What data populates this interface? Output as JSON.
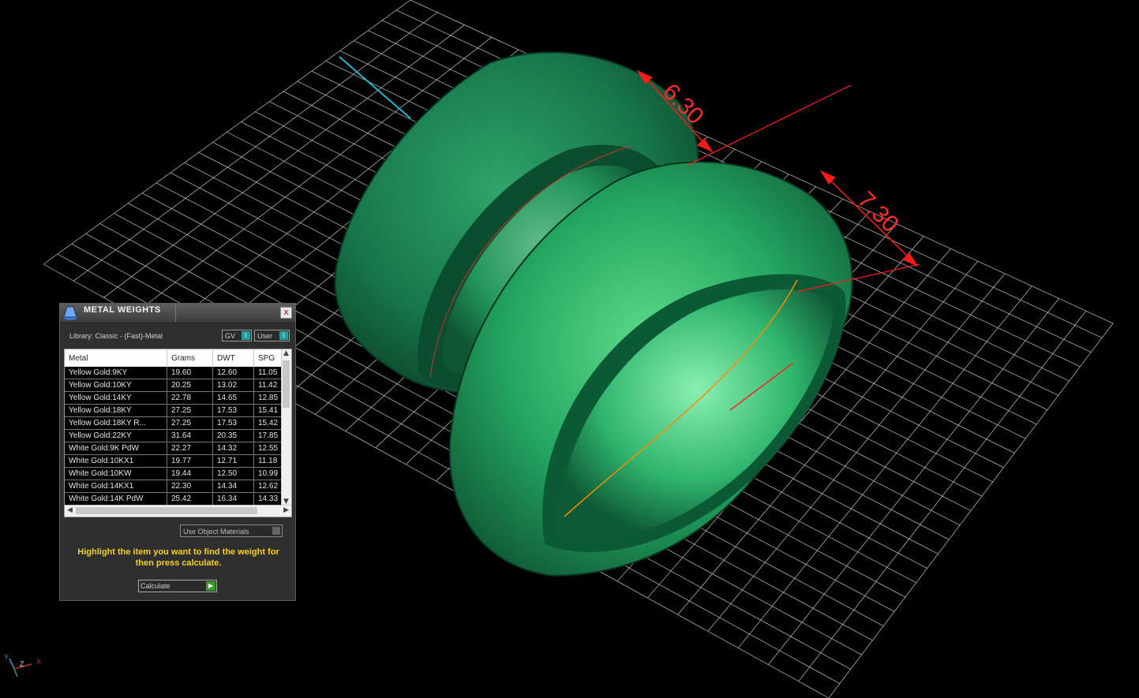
{
  "viewport": {
    "dimension_1": "6.30",
    "dimension_2": "7.30",
    "axis_labels": {
      "y": "Y",
      "z": "Z",
      "x": "X"
    }
  },
  "panel": {
    "title": "METAL WEIGHTS",
    "close_label": "x",
    "library_label": "Library: Classic - (Fast)-Metal",
    "gv_label": "GV",
    "user_label": "User",
    "toggle_glyph": "I",
    "columns": [
      "Metal",
      "Grams",
      "DWT",
      "SPG"
    ],
    "rows": [
      [
        "Yellow Gold:9KY",
        "19.60",
        "12.60",
        "11.05"
      ],
      [
        "Yellow Gold:10KY",
        "20.25",
        "13.02",
        "11.42"
      ],
      [
        "Yellow Gold:14KY",
        "22.78",
        "14.65",
        "12.85"
      ],
      [
        "Yellow Gold:18KY",
        "27.25",
        "17.53",
        "15.41"
      ],
      [
        "Yellow Gold:18KY R...",
        "27.25",
        "17.53",
        "15.42"
      ],
      [
        "Yellow Gold:22KY",
        "31.64",
        "20.35",
        "17.85"
      ],
      [
        "White Gold:9K PdW",
        "22.27",
        "14.32",
        "12.55"
      ],
      [
        "White Gold:10KX1",
        "19.77",
        "12.71",
        "11.18"
      ],
      [
        "White Gold:10KW",
        "19.44",
        "12.50",
        "10.99"
      ],
      [
        "White Gold:14KX1",
        "22.30",
        "14.34",
        "12.62"
      ],
      [
        "White Gold:14K PdW",
        "25.42",
        "16.34",
        "14.33"
      ]
    ],
    "use_object_materials": "Use Object Materials",
    "instruction": "Highlight the item you want to find the weight for then press calculate.",
    "calculate_label": "Calculate"
  },
  "colors": {
    "grid": "#e8e8e8",
    "ring": "#1f8a55",
    "dimension": "#ff1a1a",
    "cyan_axis": "#23b8d0",
    "instruction_text": "#f5d020"
  }
}
